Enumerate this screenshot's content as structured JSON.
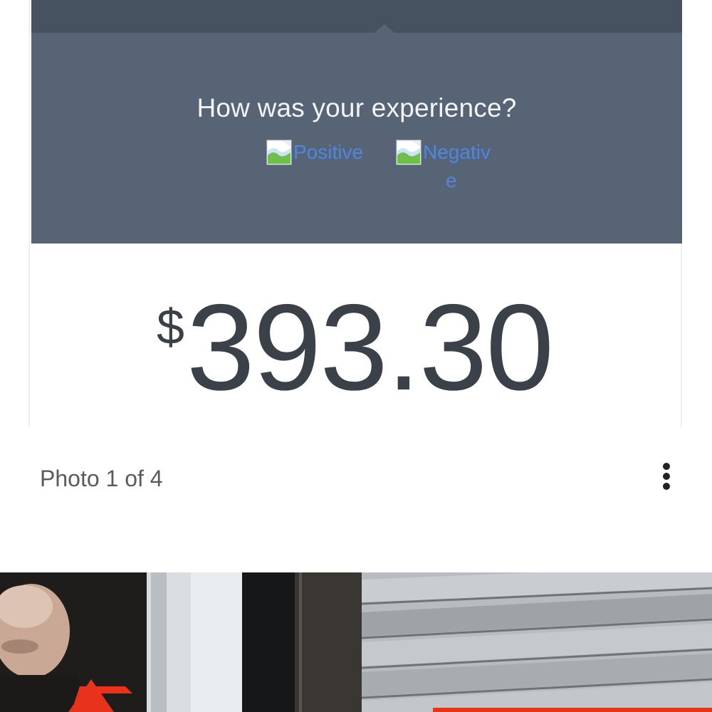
{
  "feedback": {
    "question": "How was your experience?",
    "positive_label": "Positive",
    "negative_label": "Negativ",
    "negative_label_tail": "e"
  },
  "payment": {
    "currency_symbol": "$",
    "amount": "393.30"
  },
  "photo_viewer": {
    "counter": "Photo 1 of 4",
    "menu_icon": "more-vertical-icon"
  },
  "colors": {
    "header_bar": "#475260",
    "feedback_panel": "#566475",
    "link_blue": "#4f86e4",
    "amount_text": "#3b4148",
    "annotation_red": "#e8321c"
  }
}
